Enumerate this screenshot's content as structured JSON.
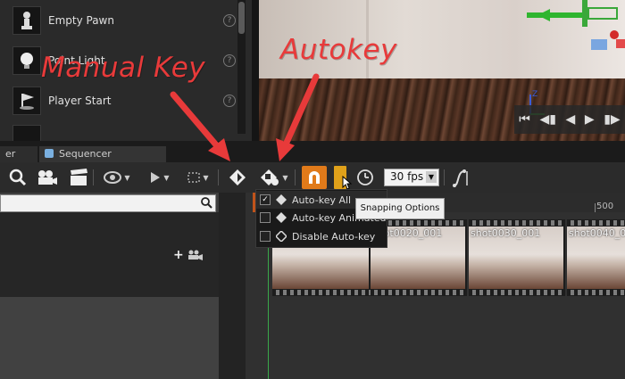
{
  "place_actors": {
    "items": [
      {
        "label": "Empty Pawn",
        "icon": "pawn-icon"
      },
      {
        "label": "Point Light",
        "icon": "point-light-icon"
      },
      {
        "label": "Player Start",
        "icon": "player-start-icon"
      },
      {
        "label": "",
        "icon": "cube-icon"
      }
    ]
  },
  "tabs": [
    {
      "label": "er"
    },
    {
      "label": "Sequencer",
      "icon": "sequencer-icon"
    }
  ],
  "toolbar": {
    "framerate": "30 fps",
    "icons": [
      "search-icon",
      "camera-icon",
      "clapper-icon",
      "eye-icon",
      "play-icon",
      "selection-icon",
      "key-icon",
      "autokey-icon",
      "snap-magnet-icon",
      "clock-icon",
      "curve-editor-icon"
    ]
  },
  "menu": {
    "items": [
      {
        "label": "Auto-key All",
        "checked": true
      },
      {
        "label": "Auto-key Animated",
        "checked": false
      },
      {
        "label": "Disable Auto-key",
        "checked": false
      }
    ]
  },
  "tooltip": {
    "text": "Snapping Options"
  },
  "timeline": {
    "ruler_label": "500",
    "shots": [
      "shot0020_001",
      "shot0030_001",
      "shot0040_0"
    ]
  },
  "annotations": {
    "manual_key": "Manual Key",
    "autokey": "Autokey",
    "color": "#e83a3a"
  },
  "colors": {
    "accent_orange": "#e07a1a",
    "playhead_green": "#3aa84a"
  }
}
